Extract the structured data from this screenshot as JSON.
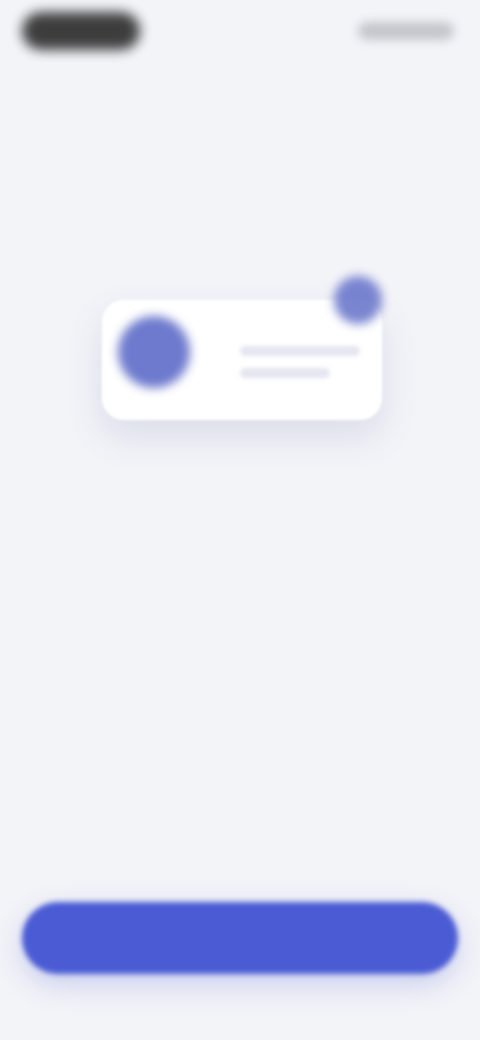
{
  "theme": {
    "background": "#f3f4f8",
    "accent": "#4a5bd4",
    "illustration_primary": "#5e6cc8",
    "title_color": "#1e1f28",
    "body_color": "#8d8f9c"
  },
  "onboarding": {
    "title": "",
    "description": "",
    "cta_label": ""
  },
  "icons": {
    "profile": "profile-circle",
    "notification": "notification-dot"
  }
}
